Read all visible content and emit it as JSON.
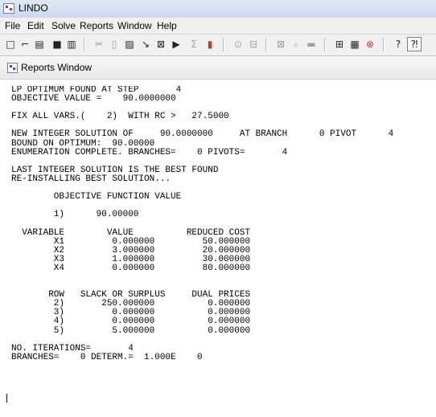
{
  "window": {
    "title": "LINDO"
  },
  "menubar": {
    "items": [
      "File",
      "Edit",
      "Solve",
      "Reports",
      "Window",
      "Help"
    ]
  },
  "toolbar": {
    "buttons": [
      {
        "icon": "new-icon",
        "glyph": "□"
      },
      {
        "icon": "open-icon",
        "glyph": "⌐"
      },
      {
        "icon": "open-folder-icon",
        "glyph": "▤"
      },
      {
        "icon": "save-icon",
        "glyph": "■"
      },
      {
        "icon": "print-icon",
        "glyph": "▥"
      },
      {
        "icon": "cut-icon",
        "glyph": "✂"
      },
      {
        "icon": "copy-icon",
        "glyph": "▯"
      },
      {
        "icon": "paste-icon",
        "glyph": "▨"
      },
      {
        "icon": "find-icon",
        "glyph": "↘"
      },
      {
        "icon": "replace-icon",
        "glyph": "⊠"
      },
      {
        "icon": "goto-line-icon",
        "glyph": "▶"
      },
      {
        "icon": "solve-icon",
        "glyph": "Σ"
      },
      {
        "icon": "compile-icon",
        "glyph": "▮"
      },
      {
        "icon": "look-icon",
        "glyph": "⊙"
      },
      {
        "icon": "picture-icon",
        "glyph": "⊟"
      },
      {
        "icon": "zoom-in-icon",
        "glyph": "⊠"
      },
      {
        "icon": "zoom-icon",
        "glyph": "⌕"
      },
      {
        "icon": "window-icon",
        "glyph": "▬"
      },
      {
        "icon": "tile-icon",
        "glyph": "⊞"
      },
      {
        "icon": "cascade-icon",
        "glyph": "▦"
      },
      {
        "icon": "close-all-icon",
        "glyph": "⊗"
      },
      {
        "icon": "help-icon",
        "glyph": "?"
      },
      {
        "icon": "context-help-icon",
        "glyph": "⁈"
      }
    ]
  },
  "report_window": {
    "title": "Reports Window",
    "content": "LP OPTIMUM FOUND AT STEP       4\nOBJECTIVE VALUE =    90.0000000\n\nFIX ALL VARS.(    2)  WITH RC >   27.5000\n\nNEW INTEGER SOLUTION OF     90.0000000     AT BRANCH      0 PIVOT      4\nBOUND ON OPTIMUM:  90.00000\nENUMERATION COMPLETE. BRANCHES=    0 PIVOTS=       4\n\nLAST INTEGER SOLUTION IS THE BEST FOUND\nRE-INSTALLING BEST SOLUTION...\n\n        OBJECTIVE FUNCTION VALUE\n\n        1)      90.00000\n\n  VARIABLE        VALUE          REDUCED COST\n        X1         0.000000         50.000000\n        X2         3.000000         20.000000\n        X3         1.000000         30.000000\n        X4         0.000000         80.000000\n\n\n       ROW   SLACK OR SURPLUS     DUAL PRICES\n        2)       250.000000          0.000000\n        3)         0.000000          0.000000\n        4)         0.000000          0.000000\n        5)         5.000000          0.000000\n\nNO. ITERATIONS=       4\nBRANCHES=    0 DETERM.=  1.000E    0"
  }
}
